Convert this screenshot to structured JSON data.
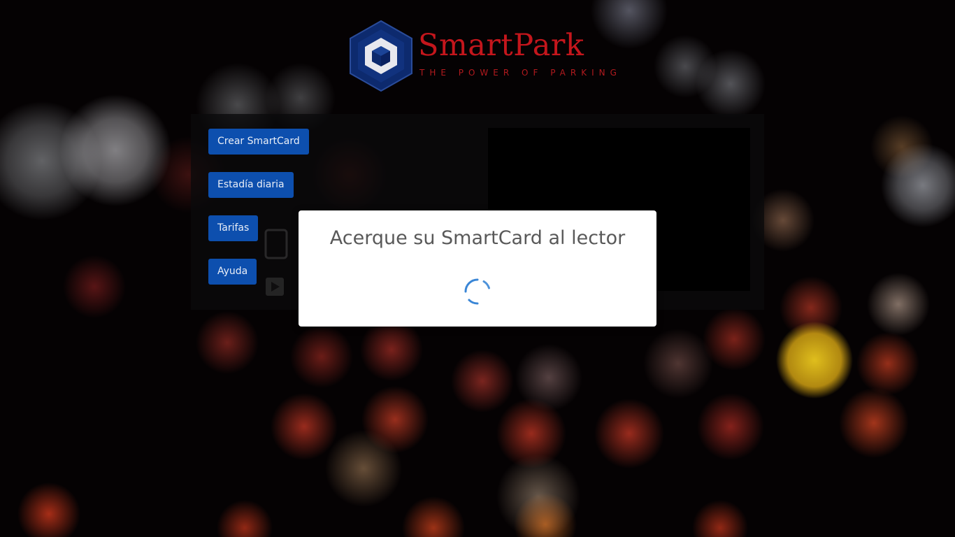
{
  "brand": {
    "name": "SmartPark",
    "tagline": "THE POWER OF PARKING",
    "logo_icon": "hexagon-cube-logo",
    "primary_color": "#c4161c",
    "logo_blue": "#0d2a6e"
  },
  "menu": {
    "items": [
      {
        "label": "Crear SmartCard"
      },
      {
        "label": "Estadía diaria"
      },
      {
        "label": "Tarifas"
      },
      {
        "label": "Ayuda"
      }
    ],
    "button_color": "#0d4fae"
  },
  "modal": {
    "title": "Acerque su SmartCard al lector",
    "spinner_icon": "loading-spinner-icon",
    "spinner_color": "#3a86d6"
  }
}
